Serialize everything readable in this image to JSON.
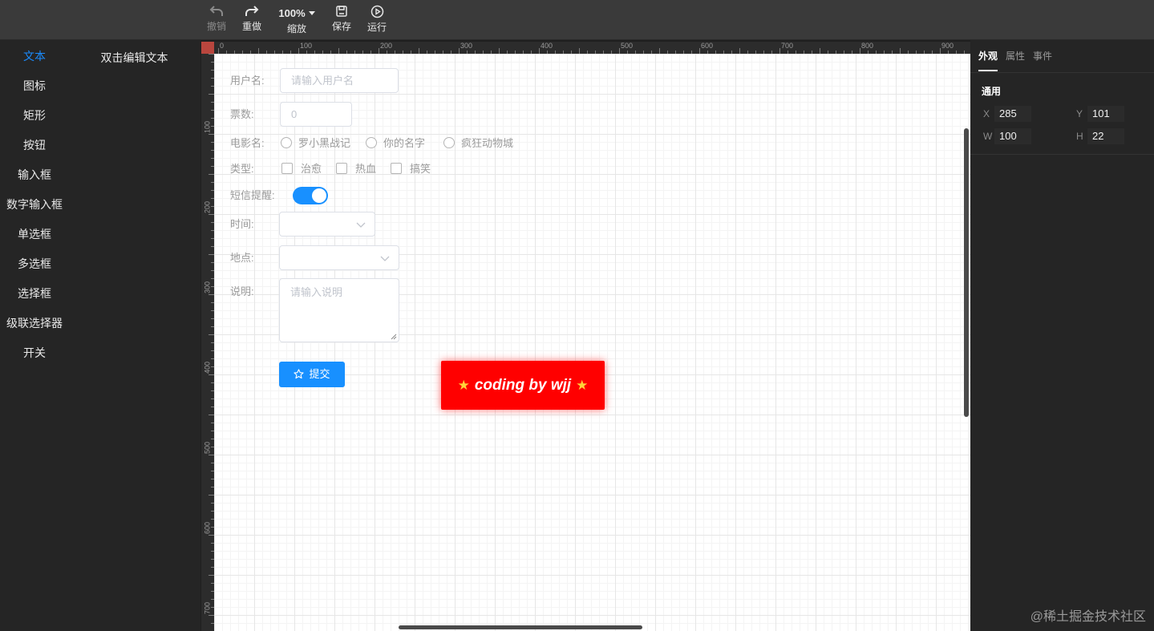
{
  "toolbar": {
    "undo_label": "撤销",
    "redo_label": "重做",
    "zoom_value": "100%",
    "zoom_label": "缩放",
    "save_label": "保存",
    "run_label": "运行"
  },
  "components": [
    {
      "label": "文本",
      "active": true
    },
    {
      "label": "图标"
    },
    {
      "label": "矩形"
    },
    {
      "label": "按钮"
    },
    {
      "label": "输入框"
    },
    {
      "label": "数字输入框"
    },
    {
      "label": "单选框"
    },
    {
      "label": "多选框"
    },
    {
      "label": "选择框"
    },
    {
      "label": "级联选择器"
    },
    {
      "label": "开关"
    }
  ],
  "component_preview": "双击编辑文本",
  "ruler": {
    "top_labels": [
      "0",
      "100",
      "200",
      "300",
      "400",
      "500",
      "600",
      "700",
      "800",
      "900"
    ],
    "left_labels": [
      "100",
      "200",
      "300",
      "400",
      "500",
      "600",
      "700"
    ]
  },
  "form": {
    "username_label": "用户名:",
    "username_placeholder": "请输入用户名",
    "tickets_label": "票数:",
    "tickets_value": "0",
    "movie_label": "电影名:",
    "movie_options": [
      "罗小黑战记",
      "你的名字",
      "疯狂动物城"
    ],
    "type_label": "类型:",
    "type_options": [
      "治愈",
      "热血",
      "搞笑"
    ],
    "sms_label": "短信提醒:",
    "sms_enabled": true,
    "time_label": "时间:",
    "place_label": "地点:",
    "desc_label": "说明:",
    "desc_placeholder": "请输入说明",
    "submit_label": "提交"
  },
  "promo": {
    "text": "coding by wjj",
    "star": "★",
    "color": "#ff0000"
  },
  "right_panel": {
    "tabs": [
      "外观",
      "属性",
      "事件"
    ],
    "active_tab": "外观",
    "section_title": "通用",
    "x_label": "X",
    "x_value": "285",
    "y_label": "Y",
    "y_value": "101",
    "w_label": "W",
    "w_value": "100",
    "h_label": "H",
    "h_value": "22"
  },
  "watermark": "@稀土掘金技术社区",
  "colors": {
    "accent": "#1890ff",
    "active_item": "#1a8cff",
    "promo_bg": "#ff0000"
  }
}
